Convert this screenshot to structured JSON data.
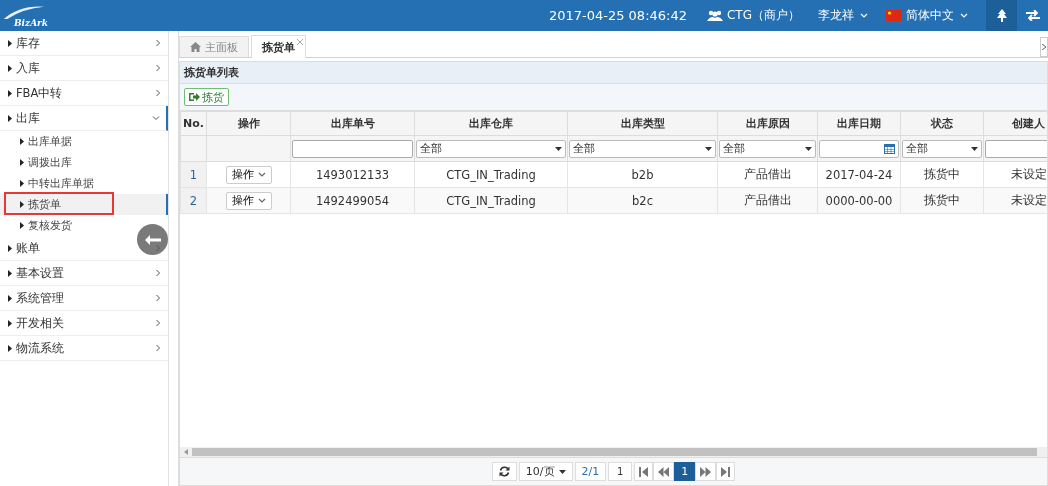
{
  "header": {
    "logo": "BizArk",
    "datetime": "2017-04-25 08:46:42",
    "tenant": "CTG（商户）",
    "user": "李龙祥",
    "language": "简体中文"
  },
  "sidebar": {
    "items": [
      {
        "label": "库存",
        "expanded": false
      },
      {
        "label": "入库",
        "expanded": false
      },
      {
        "label": "FBA中转",
        "expanded": false
      },
      {
        "label": "出库",
        "expanded": true,
        "children": [
          {
            "label": "出库单据",
            "selected": false
          },
          {
            "label": "调拨出库",
            "selected": false
          },
          {
            "label": "中转出库单据",
            "selected": false
          },
          {
            "label": "拣货单",
            "selected": true
          },
          {
            "label": "复核发货",
            "selected": false
          }
        ]
      },
      {
        "label": "账单",
        "expanded": false
      },
      {
        "label": "基本设置",
        "expanded": false
      },
      {
        "label": "系统管理",
        "expanded": false
      },
      {
        "label": "开发相关",
        "expanded": false
      },
      {
        "label": "物流系统",
        "expanded": false
      }
    ]
  },
  "tabs": [
    {
      "label": "主面板",
      "selected": false,
      "kind": "home"
    },
    {
      "label": "拣货单",
      "selected": true,
      "kind": "closable"
    }
  ],
  "panel": {
    "title": "拣货单列表",
    "toolbar_button": "拣货"
  },
  "table": {
    "columns": [
      "No.",
      "操作",
      "出库单号",
      "出库仓库",
      "出库类型",
      "出库原因",
      "出库日期",
      "状态",
      "创建人"
    ],
    "filters": [
      {
        "kind": "none"
      },
      {
        "kind": "none"
      },
      {
        "kind": "text"
      },
      {
        "kind": "select",
        "value": "全部"
      },
      {
        "kind": "select",
        "value": "全部"
      },
      {
        "kind": "select",
        "value": "全部"
      },
      {
        "kind": "date"
      },
      {
        "kind": "select",
        "value": "全部"
      },
      {
        "kind": "text"
      }
    ],
    "rows": [
      {
        "cells": [
          "1",
          "操作",
          "1493012133",
          "CTG_IN_Trading",
          "b2b",
          "产品借出",
          "2017-04-24",
          "拣货中",
          "未设定"
        ]
      },
      {
        "cells": [
          "2",
          "操作",
          "1492499054",
          "CTG_IN_Trading",
          "b2c",
          "产品借出",
          "0000-00-00",
          "拣货中",
          "未设定"
        ]
      }
    ]
  },
  "pager": {
    "page_size": "10/页",
    "pages": "2/1",
    "page_input": "1",
    "current": "1"
  }
}
